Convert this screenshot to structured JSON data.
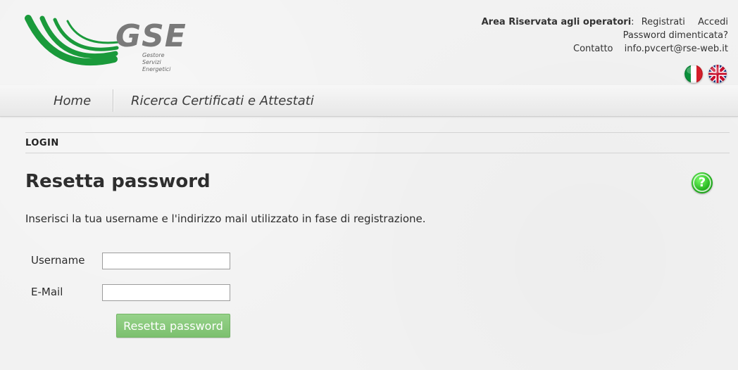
{
  "brand": {
    "logo_text": "GSE",
    "logo_subtext_lines": [
      "Gestore",
      "Servizi",
      "Energetici"
    ],
    "logo_colors": {
      "green": "#1a9a3b",
      "gray": "#7a7a7a"
    }
  },
  "top_links": {
    "area_label": "Area Riservata agli operatori",
    "area_separator": ":",
    "registrati": "Registrati",
    "accedi": "Accedi",
    "password_dimenticata": "Password dimenticata?",
    "contatto": "Contatto",
    "email": "info.pvcert@rse-web.it"
  },
  "flags": [
    {
      "name": "italian-flag-icon",
      "label": "Italiano"
    },
    {
      "name": "uk-flag-icon",
      "label": "English"
    }
  ],
  "nav": {
    "home": "Home",
    "ricerca": "Ricerca Certificati e Attestati"
  },
  "breadcrumb": {
    "current": "LOGIN"
  },
  "page": {
    "title": "Resetta password",
    "description": "Inserisci la tua username e l'indirizzo mail utilizzato in fase di registrazione."
  },
  "form": {
    "username_label": "Username",
    "username_value": "",
    "email_label": "E-Mail",
    "email_value": "",
    "submit_label": "Resetta password"
  },
  "help": {
    "icon": "help-icon",
    "symbol": "?",
    "color": "#1eae19"
  }
}
